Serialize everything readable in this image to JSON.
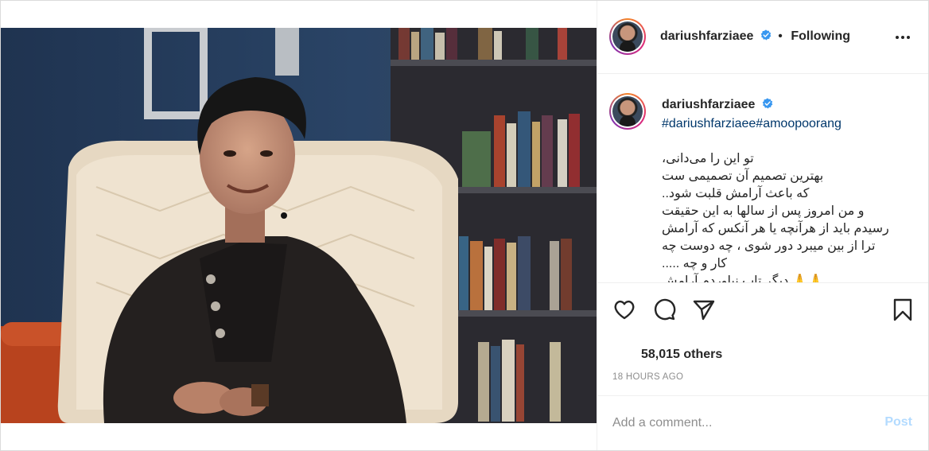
{
  "post": {
    "username": "dariushfarziaee",
    "following_label": "Following",
    "dot": "•",
    "verified": true
  },
  "caption": {
    "username": "dariushfarziaee",
    "hashtags": "#dariushfarziaee#amoopoorang",
    "text": "تو این را می‌دانی،\nبهترین تصمیم آن تصمیمی ست\nکه باعث آرامش قلبت شود..\nو من امروز پس از سالها به این حقیقت\nرسیدم باید از هرآنچه یا هر آنکس که آرامش\nترا از بین میبرد دور شوی ، چه دوست چه\nکار و چه .....\n🙏🙏 دیگر تاب نیاوردم آرامش"
  },
  "stats": {
    "likes_label": "58,015 others",
    "time_label": "18 HOURS AGO"
  },
  "comment": {
    "placeholder": "Add a comment...",
    "post_label": "Post"
  },
  "colors": {
    "link": "#00376b",
    "verified": "#3897f0",
    "post_disabled": "#b3dbff",
    "muted": "#8e8e8e"
  },
  "icons": [
    "more-options-icon",
    "verified-icon",
    "heart-icon",
    "comment-icon",
    "share-icon",
    "bookmark-icon"
  ]
}
